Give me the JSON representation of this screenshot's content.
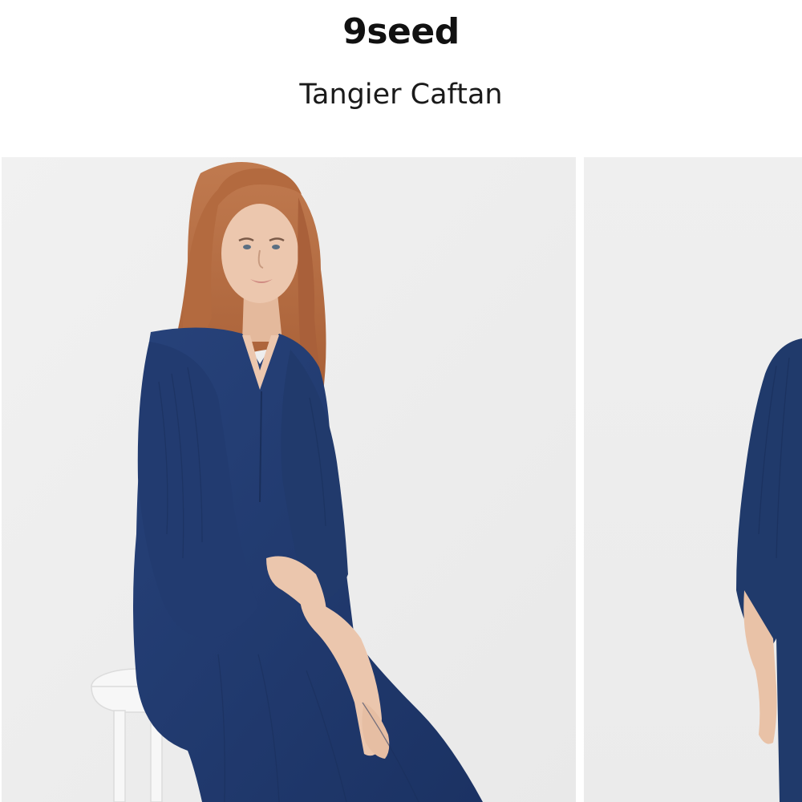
{
  "header": {
    "brand": "9seed",
    "product_name": "Tangier Caftan"
  },
  "gallery": {
    "images": [
      {
        "label": "model seated on white stool wearing navy caftan"
      },
      {
        "label": "side view of navy caftan"
      }
    ]
  },
  "colors": {
    "background": "#ffffff",
    "photo_backdrop": "#eeeeee",
    "dress_navy": "#213a6c",
    "hair_auburn": "#b5693f",
    "skin": "#ebc6ad",
    "stool_white": "#f7f7f7"
  }
}
